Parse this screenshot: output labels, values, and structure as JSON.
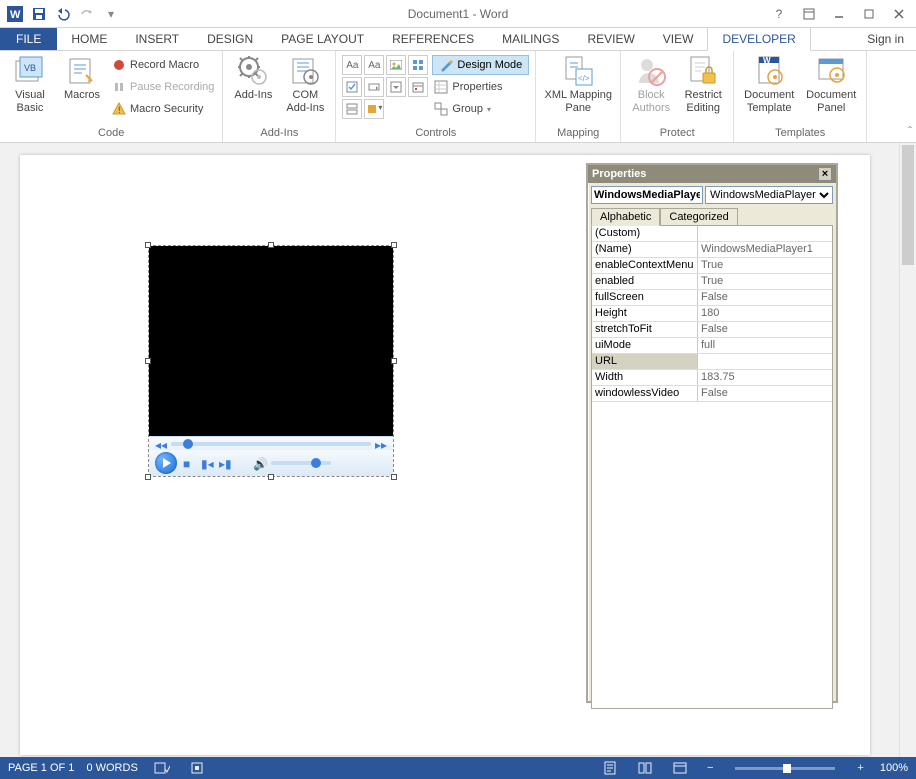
{
  "title": "Document1 - Word",
  "signin": "Sign in",
  "tabs": [
    "FILE",
    "HOME",
    "INSERT",
    "DESIGN",
    "PAGE LAYOUT",
    "REFERENCES",
    "MAILINGS",
    "REVIEW",
    "VIEW",
    "DEVELOPER"
  ],
  "active_tab": "DEVELOPER",
  "ribbon": {
    "code": {
      "label": "Code",
      "visual_basic": "Visual\nBasic",
      "macros": "Macros",
      "record": "Record Macro",
      "pause": "Pause Recording",
      "security": "Macro Security"
    },
    "addins": {
      "label": "Add-Ins",
      "addins": "Add-Ins",
      "com": "COM\nAdd-Ins"
    },
    "controls": {
      "label": "Controls",
      "design_mode": "Design Mode",
      "properties": "Properties",
      "group": "Group"
    },
    "mapping": {
      "label": "Mapping",
      "xml": "XML Mapping\nPane"
    },
    "protect": {
      "label": "Protect",
      "block": "Block\nAuthors",
      "restrict": "Restrict\nEditing"
    },
    "templates": {
      "label": "Templates",
      "doc_tmpl": "Document\nTemplate",
      "doc_panel": "Document\nPanel"
    }
  },
  "properties": {
    "window_title": "Properties",
    "object_name": "WindowsMediaPlayer",
    "object_type": "WindowsMediaPlayer",
    "tab_alpha": "Alphabetic",
    "tab_cat": "Categorized",
    "rows": [
      {
        "k": "(Custom)",
        "v": ""
      },
      {
        "k": "(Name)",
        "v": "WindowsMediaPlayer1"
      },
      {
        "k": "enableContextMenu",
        "v": "True"
      },
      {
        "k": "enabled",
        "v": "True"
      },
      {
        "k": "fullScreen",
        "v": "False"
      },
      {
        "k": "Height",
        "v": "180"
      },
      {
        "k": "stretchToFit",
        "v": "False"
      },
      {
        "k": "uiMode",
        "v": "full"
      },
      {
        "k": "URL",
        "v": ""
      },
      {
        "k": "Width",
        "v": "183.75"
      },
      {
        "k": "windowlessVideo",
        "v": "False"
      }
    ]
  },
  "status": {
    "page": "PAGE 1 OF 1",
    "words": "0 WORDS",
    "zoom": "100%"
  }
}
